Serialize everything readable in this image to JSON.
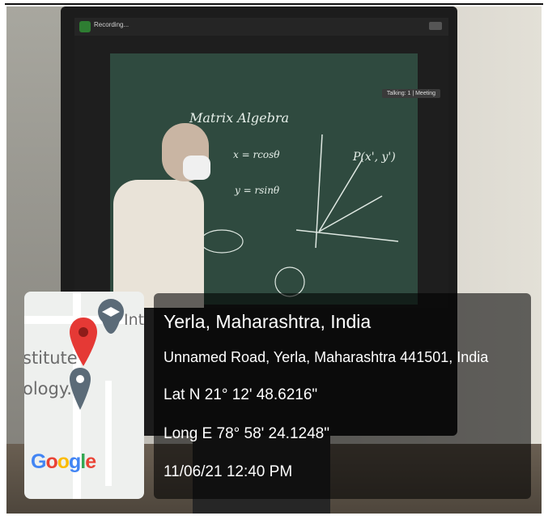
{
  "meeting": {
    "title": "Recording..."
  },
  "board": {
    "heading": "Matrix Algebra",
    "eq1": "x = rcosθ",
    "eq2": "y = rsinθ",
    "point_label": "P(x', y')"
  },
  "share_badge": "Talking: 1 | Meeting",
  "map": {
    "label_institute": "stitute",
    "label_technology": "ology...",
    "label_int": "Int",
    "brand": "Google",
    "pin_color": "#e53935",
    "icon": "map-pin-icon"
  },
  "location": {
    "place": "Yerla, Maharashtra, India",
    "address": "Unnamed Road, Yerla, Maharashtra 441501, India",
    "latitude": "Lat N 21° 12' 48.6216\"",
    "longitude": "Long E 78° 58' 24.1248\"",
    "datetime": "11/06/21 12:40 PM"
  }
}
